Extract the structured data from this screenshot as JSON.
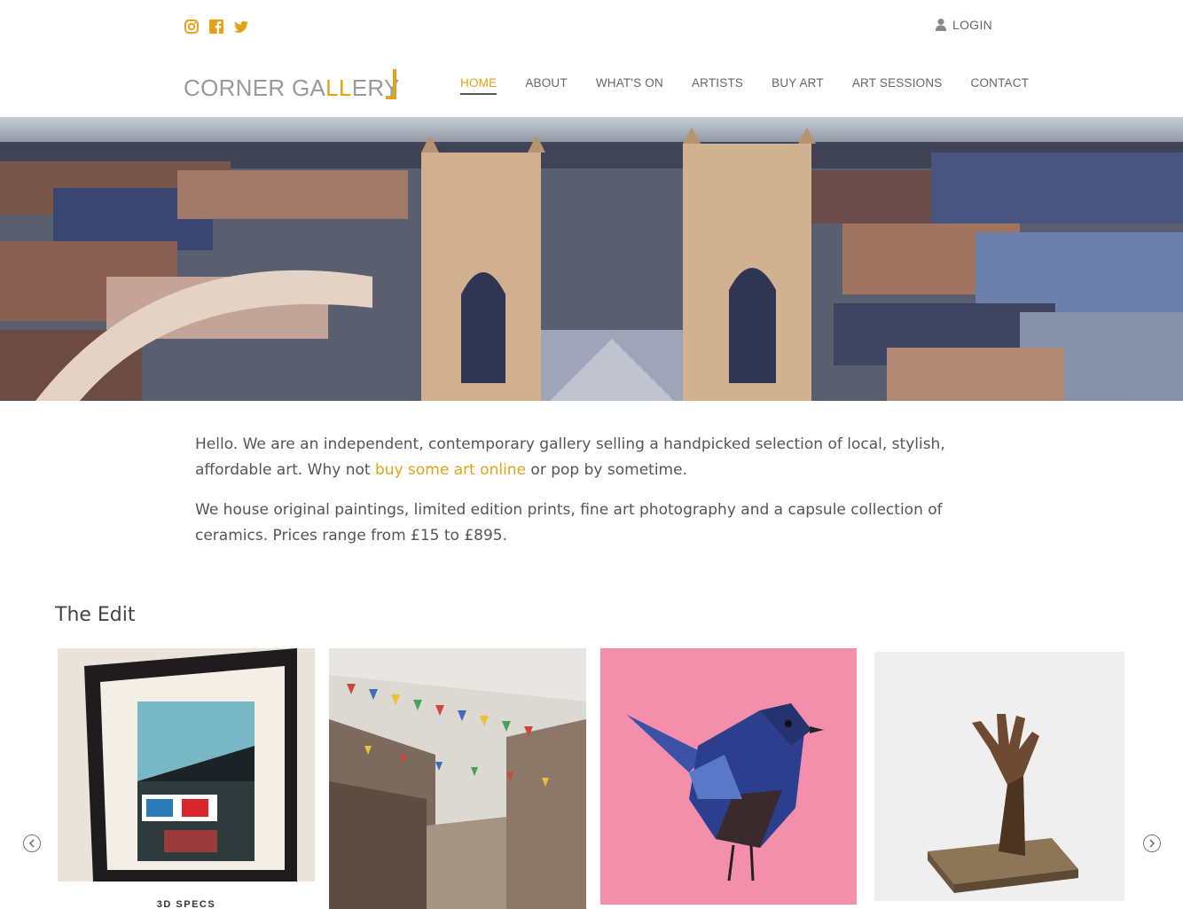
{
  "header": {
    "social": [
      "instagram-icon",
      "facebook-icon",
      "twitter-icon"
    ],
    "login_label": "LOGIN",
    "logo": {
      "part1": "CORNER GA",
      "highlight": "LL",
      "part2": "ERY"
    },
    "nav": [
      "HOME",
      "ABOUT",
      "WHAT'S ON",
      "ARTISTS",
      "BUY ART",
      "ART SESSIONS",
      "CONTACT"
    ],
    "active_nav": "HOME"
  },
  "intro": {
    "p1_start": "Hello. We are an independent, contemporary gallery selling a handpicked selection of local, stylish, affordable art. Why not ",
    "p1_link": "buy some art online",
    "p1_end": " or pop by sometime.",
    "p2": "We house original paintings, limited edition prints, fine art photography and a capsule collection of ceramics. Prices range from £15 to £895."
  },
  "edit": {
    "title": "The Edit",
    "items": [
      {
        "caption": "3D SPECS"
      },
      {
        "caption": ""
      },
      {
        "caption": ""
      },
      {
        "caption": ""
      }
    ]
  },
  "colors": {
    "accent": "#e3a21a",
    "text": "#555555"
  }
}
